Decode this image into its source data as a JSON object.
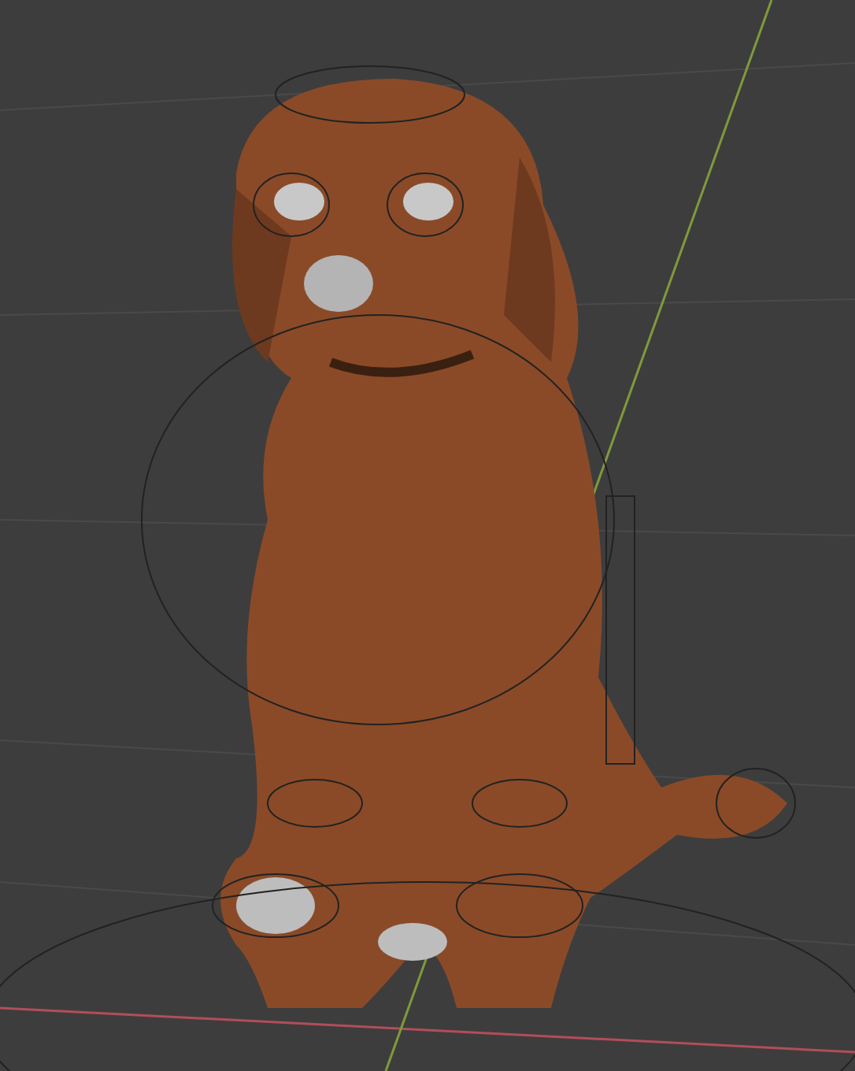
{
  "viewport": {
    "kind": "perspective",
    "axes": [
      {
        "kind": "x",
        "color": "#b34d5a"
      },
      {
        "kind": "y",
        "color": "#7f9a3c"
      }
    ]
  }
}
